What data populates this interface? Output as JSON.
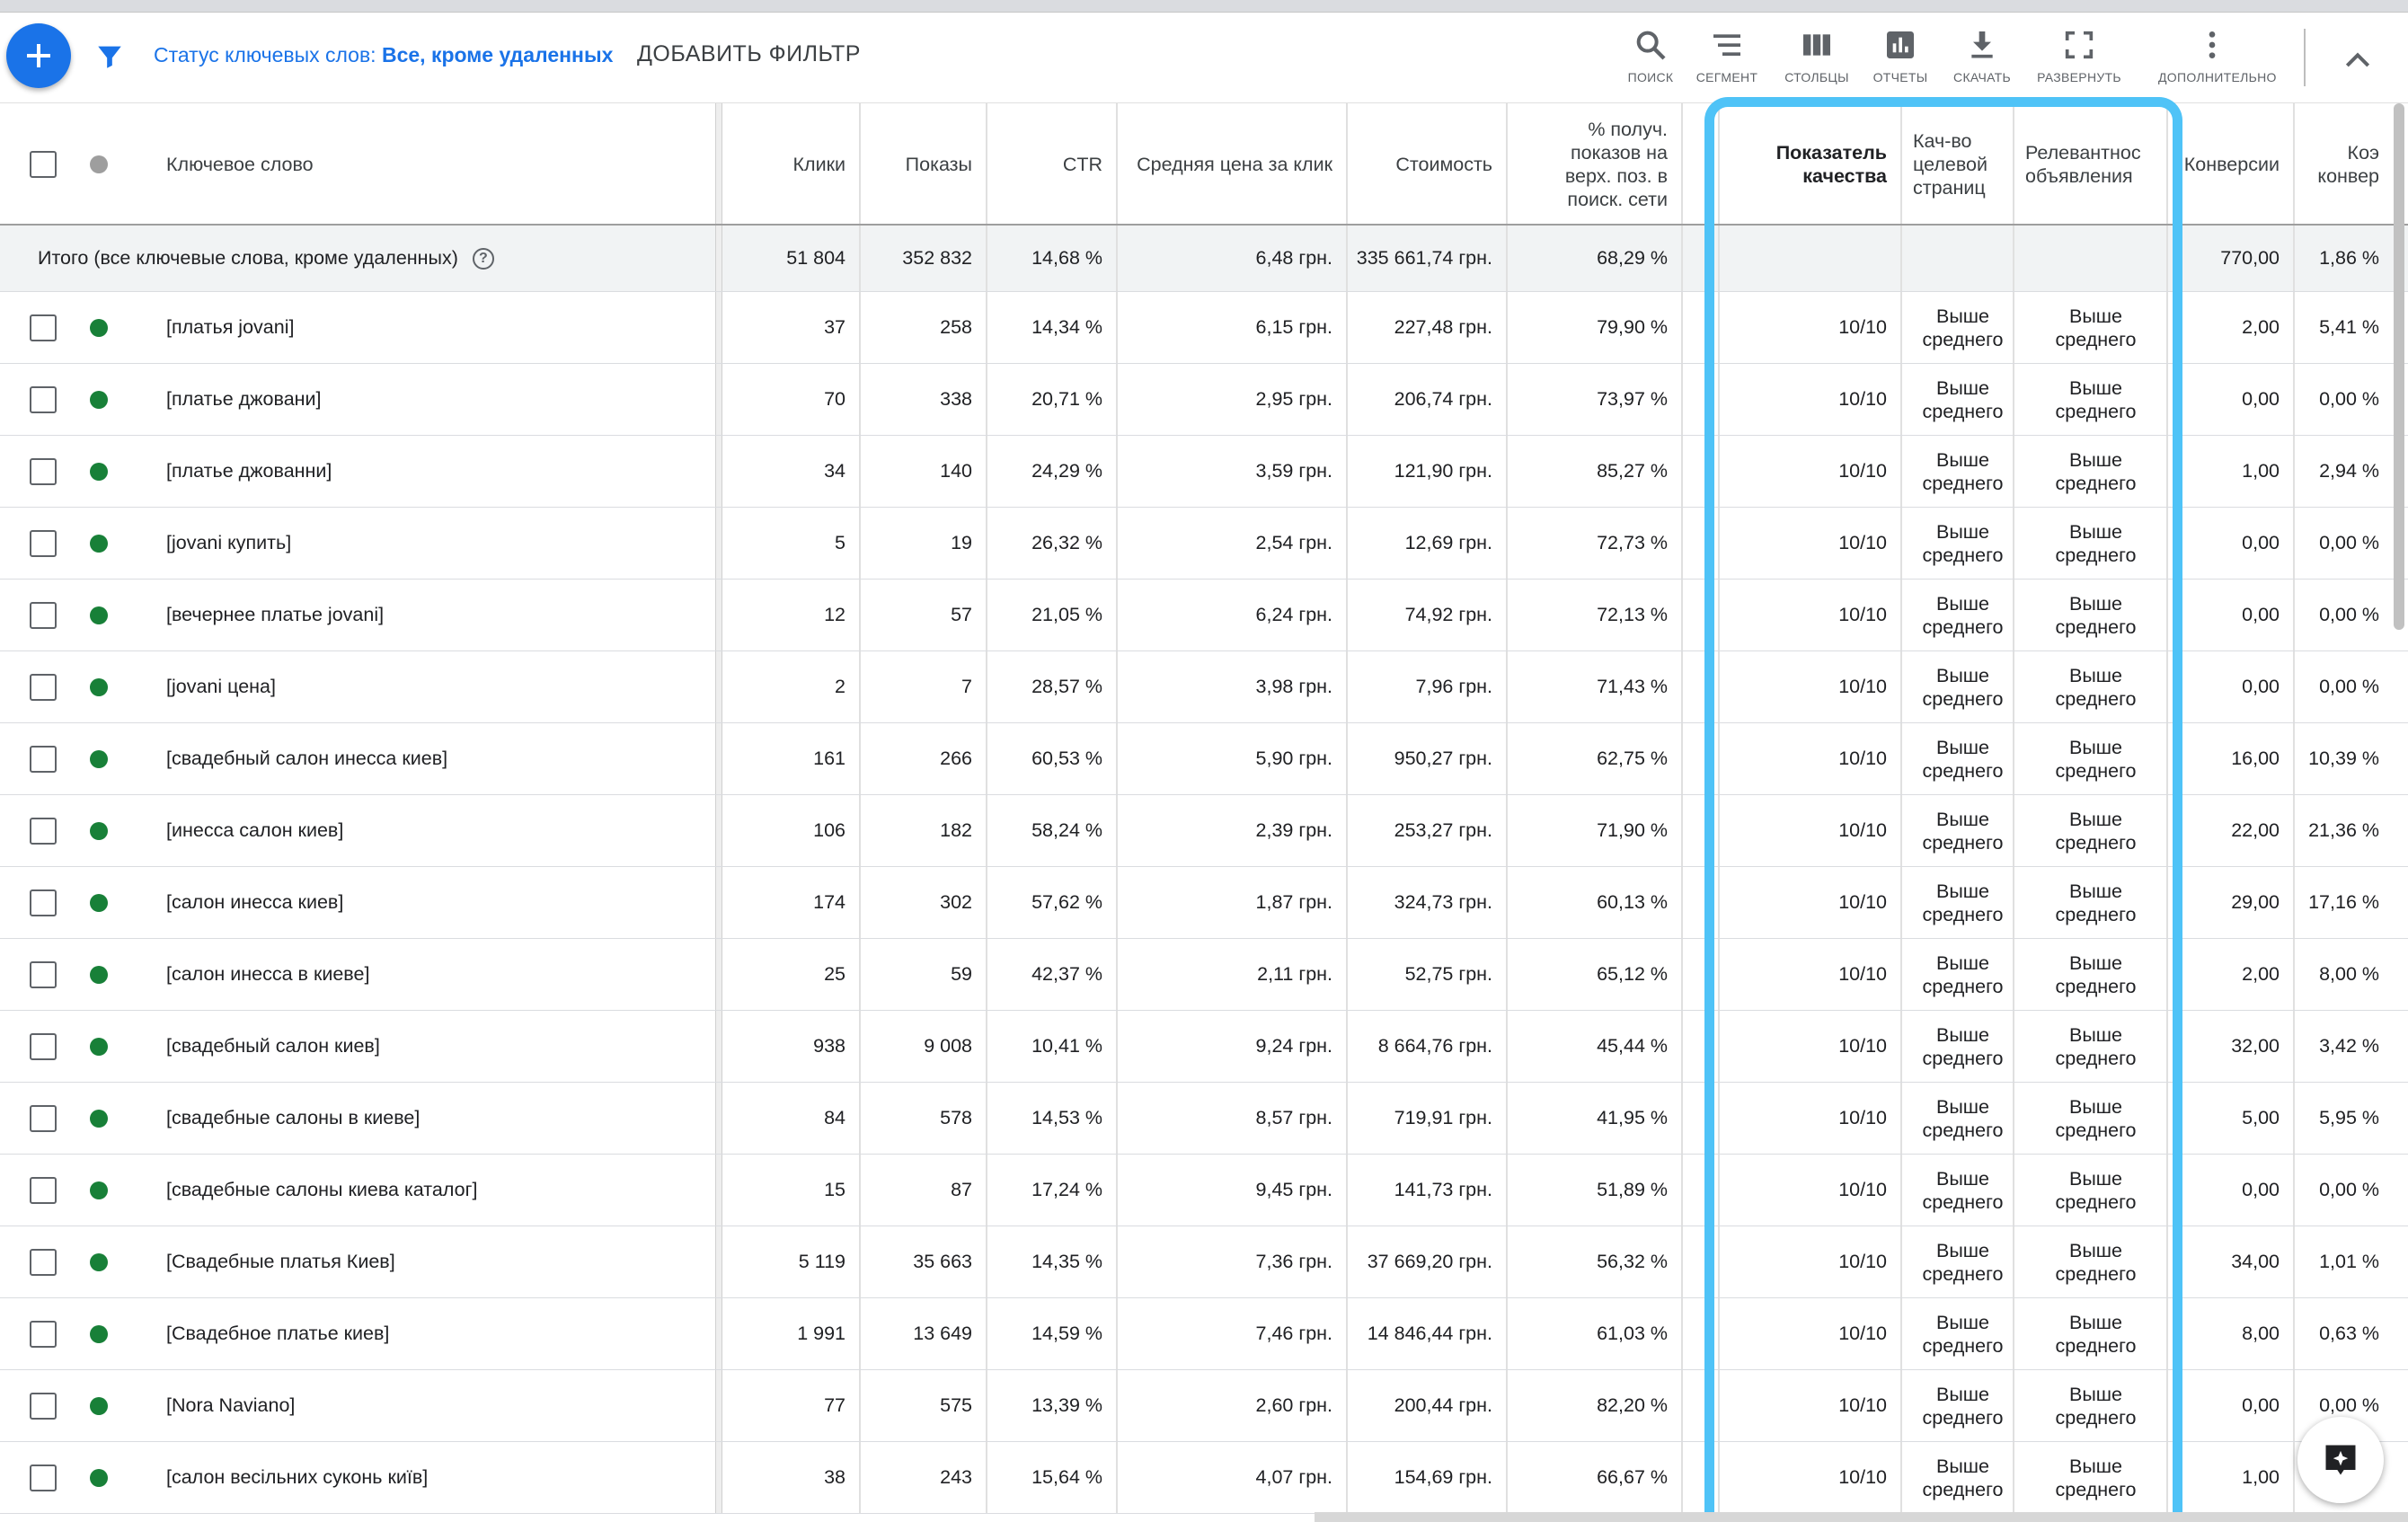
{
  "toolbar": {
    "filter_status_label": "Статус ключевых слов:",
    "filter_status_value": "Все, кроме удаленных",
    "add_filter_label": "ДОБАВИТЬ ФИЛЬТР",
    "tools": [
      {
        "label": "ПОИСК",
        "icon": "search-icon"
      },
      {
        "label": "СЕГМЕНТ",
        "icon": "segment-icon"
      },
      {
        "label": "СТОЛБЦЫ",
        "icon": "columns-icon"
      },
      {
        "label": "ОТЧЕТЫ",
        "icon": "reports-icon"
      },
      {
        "label": "СКАЧАТЬ",
        "icon": "download-icon"
      },
      {
        "label": "РАЗВЕРНУТЬ",
        "icon": "fullscreen-icon"
      },
      {
        "label": "ДОПОЛНИТЕЛЬНО",
        "icon": "more-vert-icon"
      }
    ]
  },
  "table": {
    "headers": {
      "keyword": "Ключевое слово",
      "clicks": "Клики",
      "impressions": "Показы",
      "ctr": "CTR",
      "avg_cpc": "Средняя цена за клик",
      "cost": "Стоимость",
      "top_is": [
        "% получ.",
        "показов на",
        "верх. поз. в",
        "поиск. сети"
      ],
      "quality_score": [
        "Показатель",
        "качества"
      ],
      "landing_page": [
        "Кач-во",
        "целевой",
        "страниц"
      ],
      "ad_relevance": [
        "Релевантнос",
        "объявления"
      ],
      "conversions": "Конверсии",
      "conv_rate": [
        "Коэ",
        "конвер"
      ]
    },
    "totals": {
      "label": "Итого (все ключевые слова, кроме удаленных)",
      "clicks": "51 804",
      "impressions": "352 832",
      "ctr": "14,68 %",
      "avg_cpc": "6,48 грн.",
      "cost": "335 661,74 грн.",
      "top_is": "68,29 %",
      "conversions": "770,00",
      "conv_rate": "1,86 %"
    },
    "rows": [
      {
        "keyword": "[платья jovani]",
        "clicks": "37",
        "impressions": "258",
        "ctr": "14,34 %",
        "avg_cpc": "6,15 грн.",
        "cost": "227,48 грн.",
        "top_is": "79,90 %",
        "qs": "10/10",
        "lp": [
          "Выше",
          "среднего"
        ],
        "rel": [
          "Выше",
          "среднего"
        ],
        "conv": "2,00",
        "conv_rate": "5,41 %"
      },
      {
        "keyword": "[платье джовани]",
        "clicks": "70",
        "impressions": "338",
        "ctr": "20,71 %",
        "avg_cpc": "2,95 грн.",
        "cost": "206,74 грн.",
        "top_is": "73,97 %",
        "qs": "10/10",
        "lp": [
          "Выше",
          "среднего"
        ],
        "rel": [
          "Выше",
          "среднего"
        ],
        "conv": "0,00",
        "conv_rate": "0,00 %"
      },
      {
        "keyword": "[платье джованни]",
        "clicks": "34",
        "impressions": "140",
        "ctr": "24,29 %",
        "avg_cpc": "3,59 грн.",
        "cost": "121,90 грн.",
        "top_is": "85,27 %",
        "qs": "10/10",
        "lp": [
          "Выше",
          "среднего"
        ],
        "rel": [
          "Выше",
          "среднего"
        ],
        "conv": "1,00",
        "conv_rate": "2,94 %"
      },
      {
        "keyword": "[jovani купить]",
        "clicks": "5",
        "impressions": "19",
        "ctr": "26,32 %",
        "avg_cpc": "2,54 грн.",
        "cost": "12,69 грн.",
        "top_is": "72,73 %",
        "qs": "10/10",
        "lp": [
          "Выше",
          "среднего"
        ],
        "rel": [
          "Выше",
          "среднего"
        ],
        "conv": "0,00",
        "conv_rate": "0,00 %"
      },
      {
        "keyword": "[вечернее платье jovani]",
        "clicks": "12",
        "impressions": "57",
        "ctr": "21,05 %",
        "avg_cpc": "6,24 грн.",
        "cost": "74,92 грн.",
        "top_is": "72,13 %",
        "qs": "10/10",
        "lp": [
          "Выше",
          "среднего"
        ],
        "rel": [
          "Выше",
          "среднего"
        ],
        "conv": "0,00",
        "conv_rate": "0,00 %"
      },
      {
        "keyword": "[jovani цена]",
        "clicks": "2",
        "impressions": "7",
        "ctr": "28,57 %",
        "avg_cpc": "3,98 грн.",
        "cost": "7,96 грн.",
        "top_is": "71,43 %",
        "qs": "10/10",
        "lp": [
          "Выше",
          "среднего"
        ],
        "rel": [
          "Выше",
          "среднего"
        ],
        "conv": "0,00",
        "conv_rate": "0,00 %"
      },
      {
        "keyword": "[свадебный салон инесса киев]",
        "clicks": "161",
        "impressions": "266",
        "ctr": "60,53 %",
        "avg_cpc": "5,90 грн.",
        "cost": "950,27 грн.",
        "top_is": "62,75 %",
        "qs": "10/10",
        "lp": [
          "Выше",
          "среднего"
        ],
        "rel": [
          "Выше",
          "среднего"
        ],
        "conv": "16,00",
        "conv_rate": "10,39 %"
      },
      {
        "keyword": "[инесса салон киев]",
        "clicks": "106",
        "impressions": "182",
        "ctr": "58,24 %",
        "avg_cpc": "2,39 грн.",
        "cost": "253,27 грн.",
        "top_is": "71,90 %",
        "qs": "10/10",
        "lp": [
          "Выше",
          "среднего"
        ],
        "rel": [
          "Выше",
          "среднего"
        ],
        "conv": "22,00",
        "conv_rate": "21,36 %"
      },
      {
        "keyword": "[салон инесса киев]",
        "clicks": "174",
        "impressions": "302",
        "ctr": "57,62 %",
        "avg_cpc": "1,87 грн.",
        "cost": "324,73 грн.",
        "top_is": "60,13 %",
        "qs": "10/10",
        "lp": [
          "Выше",
          "среднего"
        ],
        "rel": [
          "Выше",
          "среднего"
        ],
        "conv": "29,00",
        "conv_rate": "17,16 %"
      },
      {
        "keyword": "[салон инесса в киеве]",
        "clicks": "25",
        "impressions": "59",
        "ctr": "42,37 %",
        "avg_cpc": "2,11 грн.",
        "cost": "52,75 грн.",
        "top_is": "65,12 %",
        "qs": "10/10",
        "lp": [
          "Выше",
          "среднего"
        ],
        "rel": [
          "Выше",
          "среднего"
        ],
        "conv": "2,00",
        "conv_rate": "8,00 %"
      },
      {
        "keyword": "[свадебный салон киев]",
        "clicks": "938",
        "impressions": "9 008",
        "ctr": "10,41 %",
        "avg_cpc": "9,24 грн.",
        "cost": "8 664,76 грн.",
        "top_is": "45,44 %",
        "qs": "10/10",
        "lp": [
          "Выше",
          "среднего"
        ],
        "rel": [
          "Выше",
          "среднего"
        ],
        "conv": "32,00",
        "conv_rate": "3,42 %"
      },
      {
        "keyword": "[свадебные салоны в киеве]",
        "clicks": "84",
        "impressions": "578",
        "ctr": "14,53 %",
        "avg_cpc": "8,57 грн.",
        "cost": "719,91 грн.",
        "top_is": "41,95 %",
        "qs": "10/10",
        "lp": [
          "Выше",
          "среднего"
        ],
        "rel": [
          "Выше",
          "среднего"
        ],
        "conv": "5,00",
        "conv_rate": "5,95 %"
      },
      {
        "keyword": "[свадебные салоны киева каталог]",
        "clicks": "15",
        "impressions": "87",
        "ctr": "17,24 %",
        "avg_cpc": "9,45 грн.",
        "cost": "141,73 грн.",
        "top_is": "51,89 %",
        "qs": "10/10",
        "lp": [
          "Выше",
          "среднего"
        ],
        "rel": [
          "Выше",
          "среднего"
        ],
        "conv": "0,00",
        "conv_rate": "0,00 %"
      },
      {
        "keyword": "[Свадебные платья Киев]",
        "clicks": "5 119",
        "impressions": "35 663",
        "ctr": "14,35 %",
        "avg_cpc": "7,36 грн.",
        "cost": "37 669,20 грн.",
        "top_is": "56,32 %",
        "qs": "10/10",
        "lp": [
          "Выше",
          "среднего"
        ],
        "rel": [
          "Выше",
          "среднего"
        ],
        "conv": "34,00",
        "conv_rate": "1,01 %"
      },
      {
        "keyword": "[Свадебное платье киев]",
        "clicks": "1 991",
        "impressions": "13 649",
        "ctr": "14,59 %",
        "avg_cpc": "7,46 грн.",
        "cost": "14 846,44 грн.",
        "top_is": "61,03 %",
        "qs": "10/10",
        "lp": [
          "Выше",
          "среднего"
        ],
        "rel": [
          "Выше",
          "среднего"
        ],
        "conv": "8,00",
        "conv_rate": "0,63 %"
      },
      {
        "keyword": "[Nora Naviano]",
        "clicks": "77",
        "impressions": "575",
        "ctr": "13,39 %",
        "avg_cpc": "2,60 грн.",
        "cost": "200,44 грн.",
        "top_is": "82,20 %",
        "qs": "10/10",
        "lp": [
          "Выше",
          "среднего"
        ],
        "rel": [
          "Выше",
          "среднего"
        ],
        "conv": "0,00",
        "conv_rate": "0,00 %"
      },
      {
        "keyword": "[салон весільних суконь київ]",
        "clicks": "38",
        "impressions": "243",
        "ctr": "15,64 %",
        "avg_cpc": "4,07 грн.",
        "cost": "154,69 грн.",
        "top_is": "66,67 %",
        "qs": "10/10",
        "lp": [
          "Выше",
          "среднего"
        ],
        "rel": [
          "Выше",
          "среднего"
        ],
        "conv": "1,00",
        "conv_rate": ""
      }
    ]
  },
  "colors": {
    "accent": "#1a73e8",
    "status_enabled": "#188038",
    "highlight": "#4fc3f7"
  }
}
